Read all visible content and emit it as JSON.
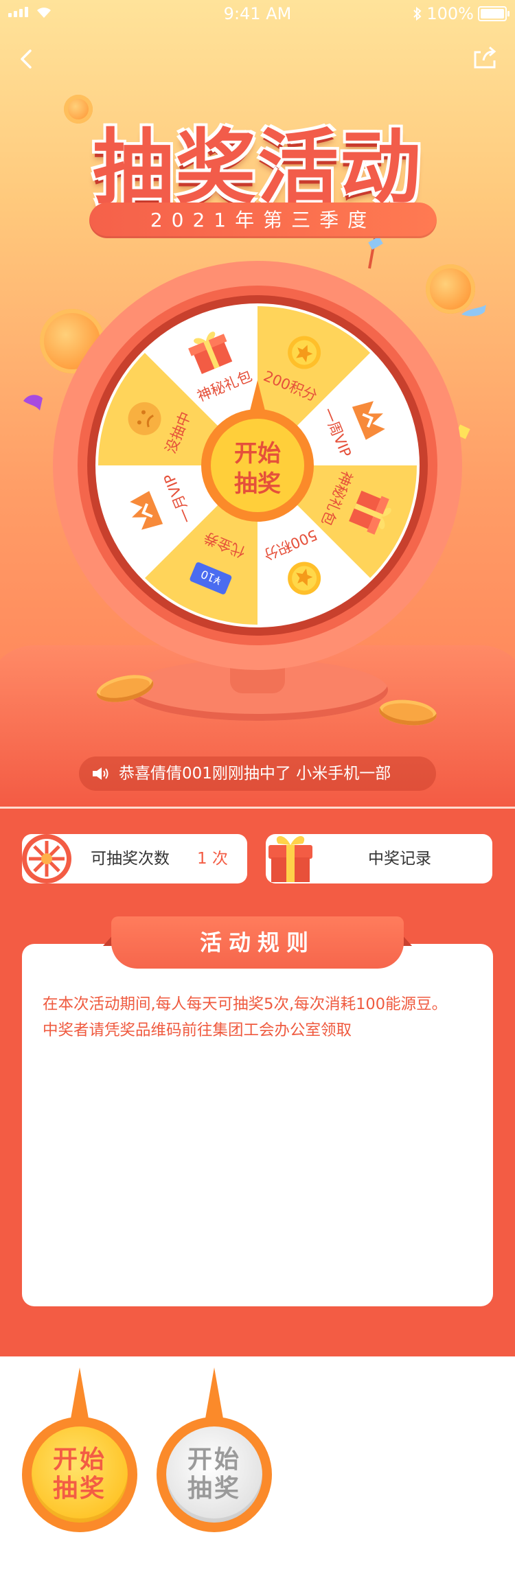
{
  "status_bar": {
    "time": "9:41 AM",
    "battery": "100%"
  },
  "header": {
    "title": "抽奖活动",
    "season": "2021年第三季度"
  },
  "wheel": {
    "center_label_line1": "开始",
    "center_label_line2": "抽奖",
    "segments": [
      {
        "label": "200积分",
        "icon": "star-coin-icon"
      },
      {
        "label": "一周VIP",
        "icon": "crown-icon"
      },
      {
        "label": "神秘礼包",
        "icon": "gift-icon"
      },
      {
        "label": "500积分",
        "icon": "star-coin-icon"
      },
      {
        "label": "代金券",
        "icon": "coupon-icon",
        "coupon_text": "¥10"
      },
      {
        "label": "一月VIP",
        "icon": "crown-icon"
      },
      {
        "label": "没抽中",
        "icon": "sad-face-icon"
      },
      {
        "label": "神秘礼包",
        "icon": "gift-icon"
      }
    ]
  },
  "notice": {
    "text": "恭喜倩倩001刚刚抽中了   小米手机一部"
  },
  "stats": {
    "draws_label": "可抽奖次数",
    "draws_count": "1 次",
    "records_label": "中奖记录"
  },
  "rules": {
    "title": "活动规则",
    "lines": [
      "在本次活动期间,每人每天可抽奖5次,每次消耗100能源豆。",
      "中奖者请凭奖品维码前往集团工会办公室领取"
    ]
  },
  "buttons": [
    {
      "line1": "开始",
      "line2": "抽奖",
      "state": "active"
    },
    {
      "line1": "开始",
      "line2": "抽奖",
      "state": "disabled"
    }
  ],
  "colors": {
    "accent": "#f35c44",
    "gold": "#ffd24a",
    "orange": "#fb8a2a"
  }
}
